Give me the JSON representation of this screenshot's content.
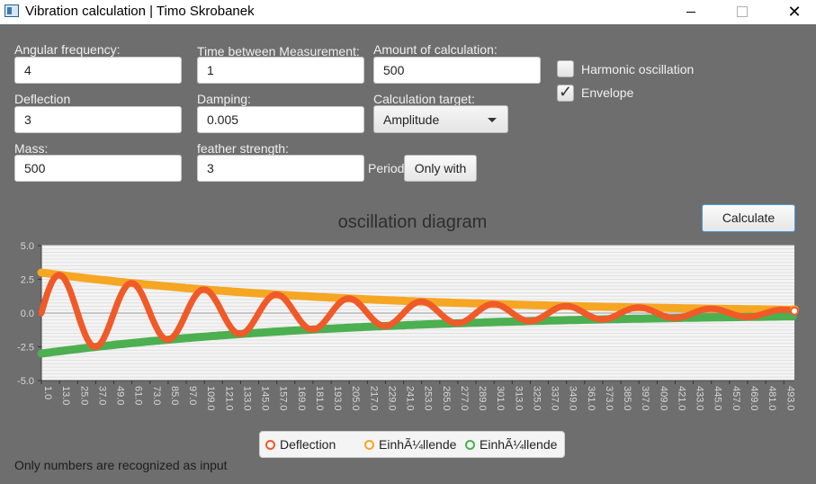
{
  "window": {
    "title": "Vibration calculation | Timo Skrobanek",
    "close_glyph": "✕"
  },
  "form": {
    "angular_frequency": {
      "label": "Angular frequency:",
      "value": "4"
    },
    "time_between": {
      "label": "Time between Measurement:",
      "value": "1"
    },
    "amount": {
      "label": "Amount of calculation:",
      "value": "500"
    },
    "deflection": {
      "label": "Deflection",
      "value": "3"
    },
    "damping": {
      "label": "Damping:",
      "value": "0.005"
    },
    "target": {
      "label": "Calculation target:",
      "value": "Amplitude"
    },
    "mass": {
      "label": "Mass:",
      "value": "500"
    },
    "feather": {
      "label": "feather strength:",
      "value": "3"
    },
    "period": {
      "label": "Period",
      "button": "Only with"
    },
    "harmonic": {
      "label": "Harmonic oscillation",
      "checked": false
    },
    "envelope": {
      "label": "Envelope",
      "checked": true
    },
    "calculate_label": "Calculate"
  },
  "chart_data": {
    "type": "line",
    "title": "oscillation diagram",
    "xlabel": "",
    "ylabel": "",
    "ylim": [
      -5.0,
      5.0
    ],
    "y_ticks": [
      "5.0",
      "2.5",
      "0.0",
      "-2.5",
      "-5.0"
    ],
    "x_ticks": [
      "1.0",
      "13.0",
      "25.0",
      "37.0",
      "49.0",
      "61.0",
      "73.0",
      "85.0",
      "97.0",
      "109.0",
      "121.0",
      "133.0",
      "145.0",
      "157.0",
      "169.0",
      "181.0",
      "193.0",
      "205.0",
      "217.0",
      "229.0",
      "241.0",
      "253.0",
      "265.0",
      "277.0",
      "289.0",
      "301.0",
      "313.0",
      "325.0",
      "337.0",
      "349.0",
      "361.0",
      "373.0",
      "385.0",
      "397.0",
      "409.0",
      "421.0",
      "433.0",
      "445.0",
      "457.0",
      "469.0",
      "481.0",
      "493.0"
    ],
    "x_range": [
      1,
      500
    ],
    "series": [
      {
        "name": "Deflection",
        "color": "#f05a28",
        "amplitude": 3,
        "damping": 0.005,
        "period": 48
      },
      {
        "name": "EinhÃ¼llende",
        "color": "#f5a623",
        "envelope": "upper",
        "start": 3.0
      },
      {
        "name": "EinhÃ¼llende",
        "color": "#4caf50",
        "envelope": "lower",
        "start": -3.0
      }
    ],
    "grid": true,
    "legend_position": "bottom"
  },
  "status": "Only numbers are recognized as input"
}
